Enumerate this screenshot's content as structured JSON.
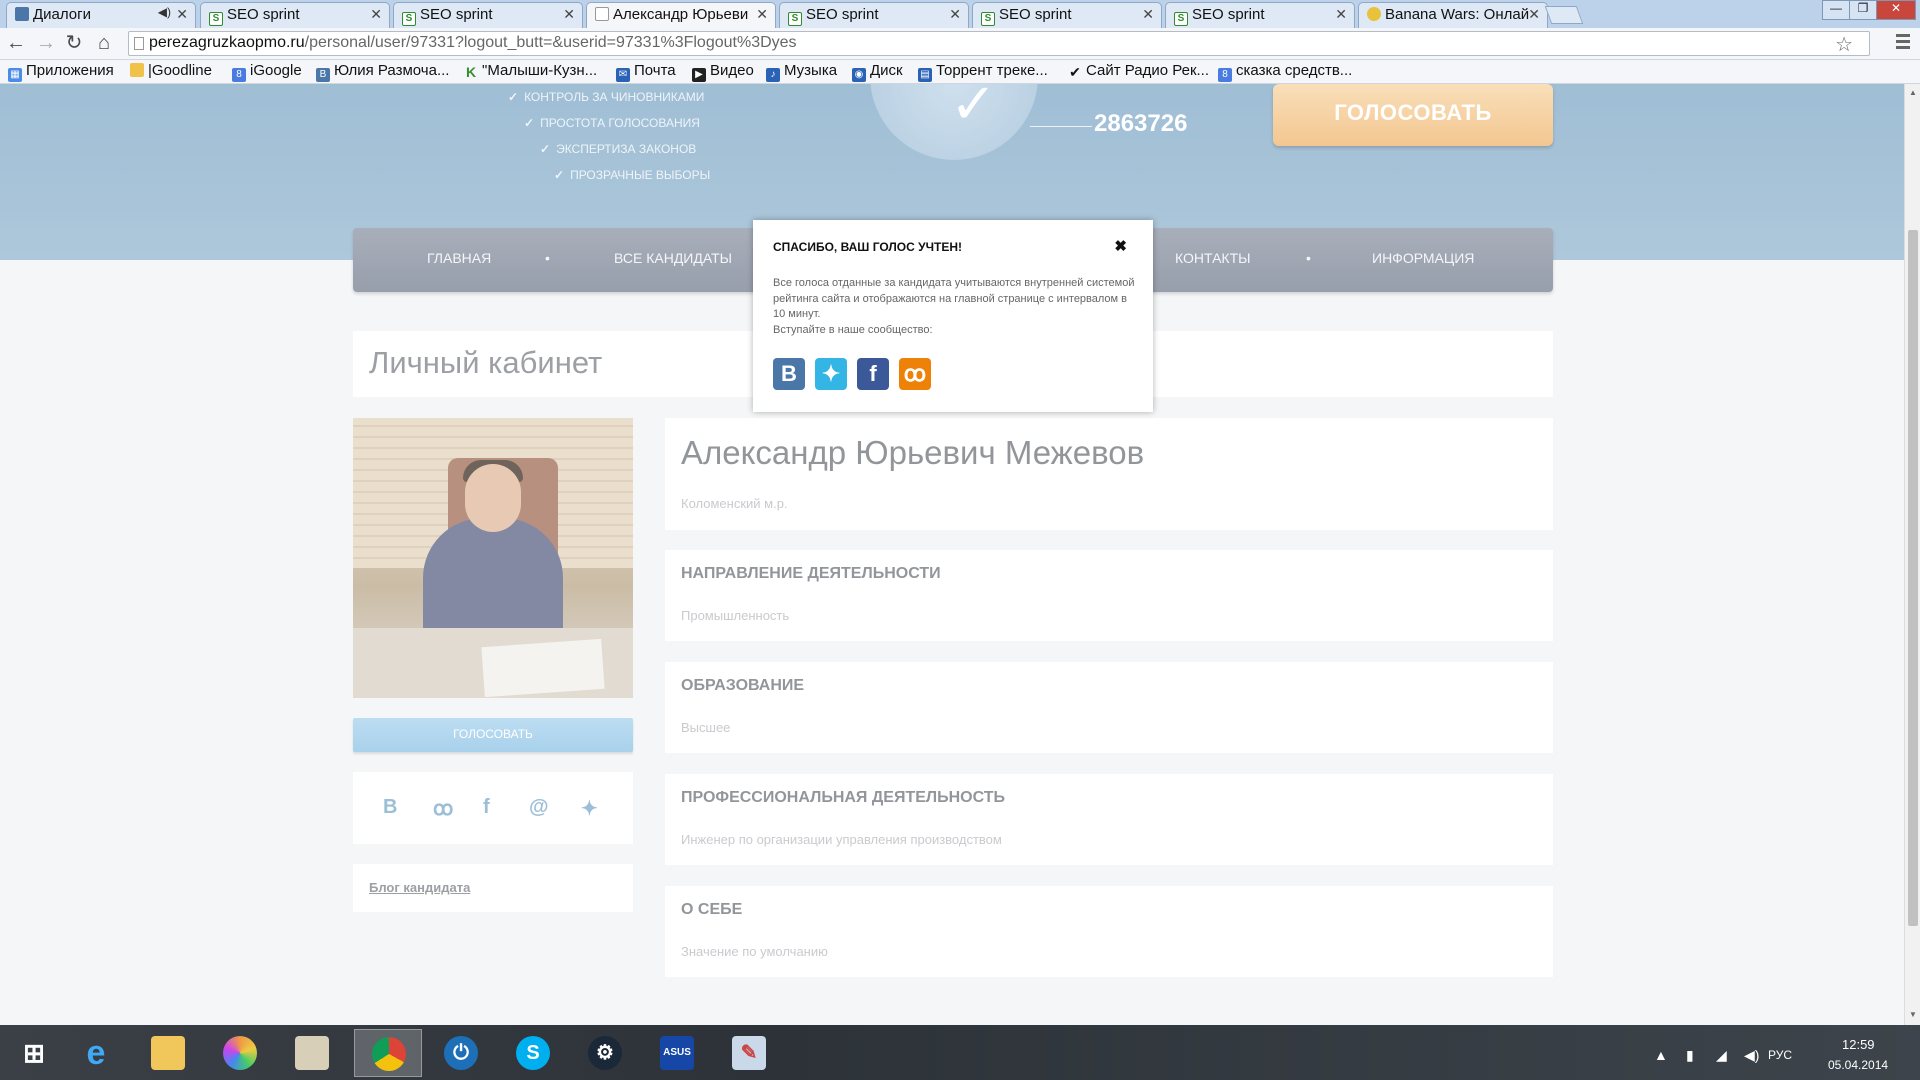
{
  "browser": {
    "tabs": [
      {
        "label": "Диалоги",
        "favicon": "vk-icon"
      },
      {
        "label": "SEO sprint",
        "favicon": "seo-sprint-icon"
      },
      {
        "label": "SEO sprint",
        "favicon": "seo-sprint-icon"
      },
      {
        "label": "Александр Юрьеви",
        "favicon": "page-icon"
      },
      {
        "label": "SEO sprint",
        "favicon": "seo-sprint-icon"
      },
      {
        "label": "SEO sprint",
        "favicon": "seo-sprint-icon"
      },
      {
        "label": "SEO sprint",
        "favicon": "seo-sprint-icon"
      },
      {
        "label": "Banana Wars: Онлай",
        "favicon": "banana-icon"
      }
    ],
    "url_host": "perezagruzkaopmo.ru",
    "url_path": "/personal/user/97331?logout_butt=&userid=97331%3Flogout%3Dyes",
    "bookmarks": [
      "Приложения",
      "|Goodline",
      "iGoogle",
      "Юлия Размоча...",
      "\"Малыши-Кузн...",
      "Почта",
      "Видео",
      "Музыка",
      "Диск",
      "Торрент треке...",
      "Сайт Радио Рек...",
      "сказка средств..."
    ]
  },
  "hero": {
    "features": [
      "КОНТРОЛЬ ЗА ЧИНОВНИКАМИ",
      "ПРОСТОТА ГОЛОСОВАНИЯ",
      "ЭКСПЕРТИЗА ЗАКОНОВ",
      "ПРОЗРАЧНЫЕ ВЫБОРЫ"
    ],
    "counter": "2863726",
    "vote_label": "ГОЛОСОВАТЬ"
  },
  "nav": {
    "items": [
      "ГЛАВНАЯ",
      "ВСЕ КАНДИДАТЫ",
      "КОНТАКТЫ",
      "ИНФОРМАЦИЯ"
    ]
  },
  "cabinet": {
    "title": "Личный кабинет",
    "vote_label": "ГОЛОСОВАТЬ",
    "blog_link": "Блог кандидата",
    "name": "Александр Юрьевич Межевов",
    "region": "Коломенский м.р.",
    "sections": [
      {
        "heading": "НАПРАВЛЕНИЕ ДЕЯТЕЛЬНОСТИ",
        "value": "Промышленность"
      },
      {
        "heading": "ОБРАЗОВАНИЕ",
        "value": "Высшее"
      },
      {
        "heading": "ПРОФЕССИОНАЛЬНАЯ ДЕЯТЕЛЬНОСТЬ",
        "value": "Инженер по организации управления производством"
      },
      {
        "heading": "О СЕБЕ",
        "value": "Значение по умолчанию"
      }
    ]
  },
  "popup": {
    "title": "СПАСИБО, ВАШ ГОЛОС УЧТЕН!",
    "text": "Все голоса отданные за кандидата учитываются внутренней системой рейтинга сайта и отображаются на главной странице с интервалом в 10 минут.",
    "join": "Вступайте в наше сообщество:"
  },
  "taskbar": {
    "lang": "РУС",
    "time": "12:59",
    "date": "05.04.2014"
  },
  "colors": {
    "hero": "#8fb2cd",
    "nav": "#7e8898",
    "vote_orange": "#f0b46c",
    "vote_blue": "#8cc2e5"
  }
}
